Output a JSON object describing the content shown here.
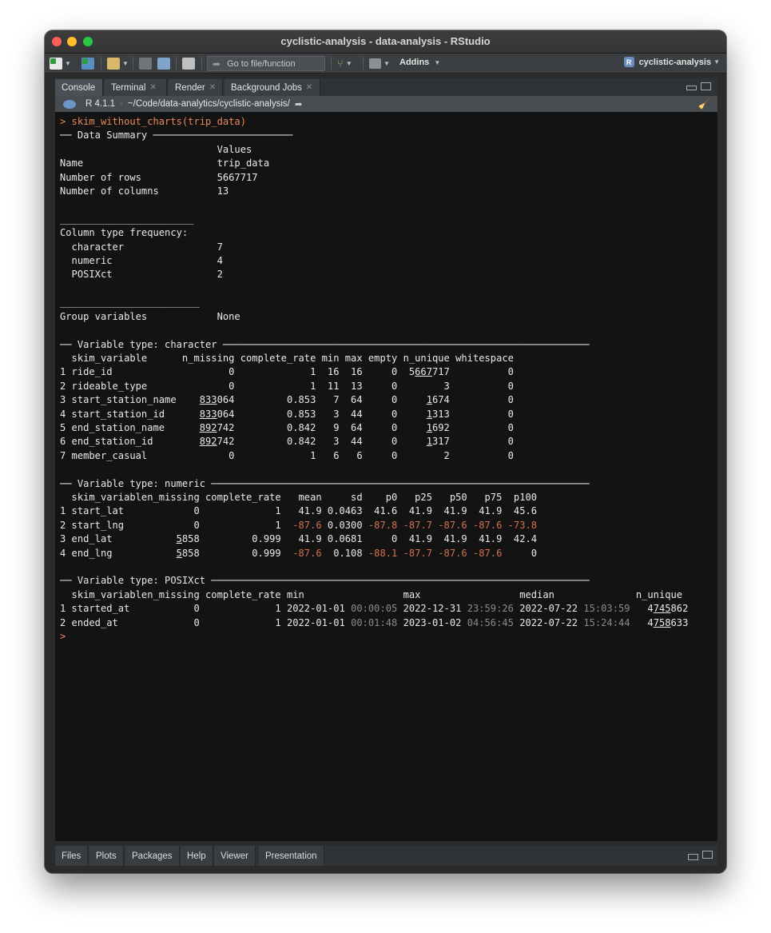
{
  "window": {
    "title": "cyclistic-analysis - data-analysis - RStudio"
  },
  "toolbar": {
    "goto_placeholder": "Go to file/function",
    "addins_label": "Addins",
    "project_label": "cyclistic-analysis"
  },
  "pane_tabs": [
    {
      "label": "Console"
    },
    {
      "label": "Terminal"
    },
    {
      "label": "Render"
    },
    {
      "label": "Background Jobs"
    }
  ],
  "console_path": {
    "r_version": "R 4.1.1",
    "path": "~/Code/data-analytics/cyclistic-analysis/"
  },
  "command": "skim_without_charts(trip_data)",
  "summary": {
    "header": "── Data Summary ────────────────────────",
    "values_header": "Values",
    "rows": [
      {
        "label": "Name",
        "value": "trip_data"
      },
      {
        "label": "Number of rows",
        "value": "5667717"
      },
      {
        "label": "Number of columns",
        "value": "13"
      }
    ],
    "separator1": "_______________________",
    "coltype_label": "Column type frequency:",
    "coltypes": [
      {
        "label": "character",
        "value": "7"
      },
      {
        "label": "numeric",
        "value": "4"
      },
      {
        "label": "POSIXct",
        "value": "2"
      }
    ],
    "separator2": "________________________",
    "group_label": "Group variables",
    "group_value": "None"
  },
  "character_section": {
    "header": "── Variable type: character ───────────────────────────────────────────────────────────────",
    "columns": [
      "skim_variable",
      "n_missing",
      "complete_rate",
      "min",
      "max",
      "empty",
      "n_unique",
      "whitespace"
    ],
    "rows": [
      [
        "1",
        "ride_id",
        "0",
        "1",
        "16",
        "16",
        "0",
        "5667717",
        "0"
      ],
      [
        "2",
        "rideable_type",
        "0",
        "1",
        "11",
        "13",
        "0",
        "3",
        "0"
      ],
      [
        "3",
        "start_station_name",
        "833064",
        "0.853",
        "7",
        "64",
        "0",
        "1674",
        "0"
      ],
      [
        "4",
        "start_station_id",
        "833064",
        "0.853",
        "3",
        "44",
        "0",
        "1313",
        "0"
      ],
      [
        "5",
        "end_station_name",
        "892742",
        "0.842",
        "9",
        "64",
        "0",
        "1692",
        "0"
      ],
      [
        "6",
        "end_station_id",
        "892742",
        "0.842",
        "3",
        "44",
        "0",
        "1317",
        "0"
      ],
      [
        "7",
        "member_casual",
        "0",
        "1",
        "6",
        "6",
        "0",
        "2",
        "0"
      ]
    ]
  },
  "numeric_section": {
    "header": "── Variable type: numeric ─────────────────────────────────────────────────────────────────",
    "columns": [
      "skim_variable",
      "n_missing",
      "complete_rate",
      "mean",
      "sd",
      "p0",
      "p25",
      "p50",
      "p75",
      "p100"
    ],
    "rows": [
      [
        "1",
        "start_lat",
        "0",
        "1",
        "41.9",
        "0.0463",
        "41.6",
        "41.9",
        "41.9",
        "41.9",
        "45.6"
      ],
      [
        "2",
        "start_lng",
        "0",
        "1",
        "-87.6",
        "0.0300",
        "-87.8",
        "-87.7",
        "-87.6",
        "-87.6",
        "-73.8"
      ],
      [
        "3",
        "end_lat",
        "5858",
        "0.999",
        "41.9",
        "0.0681",
        "0",
        "41.9",
        "41.9",
        "41.9",
        "42.4"
      ],
      [
        "4",
        "end_lng",
        "5858",
        "0.999",
        "-87.6",
        "0.108",
        "-88.1",
        "-87.7",
        "-87.6",
        "-87.6",
        "0"
      ]
    ]
  },
  "posix_section": {
    "header": "── Variable type: POSIXct ─────────────────────────────────────────────────────────────────",
    "columns": [
      "skim_variable",
      "n_missing",
      "complete_rate",
      "min",
      "max",
      "median",
      "n_unique"
    ],
    "rows": [
      [
        "1",
        "started_at",
        "0",
        "1",
        "2022-01-01",
        "00:00:05",
        "2022-12-31",
        "23:59:26",
        "2022-07-22",
        "15:03:59",
        "4745862"
      ],
      [
        "2",
        "ended_at",
        "0",
        "1",
        "2022-01-01",
        "00:01:48",
        "2023-01-02",
        "04:56:45",
        "2022-07-22",
        "15:24:44",
        "4758633"
      ]
    ]
  },
  "prompt_symbol": ">",
  "bottom_tabs": [
    {
      "label": "Files"
    },
    {
      "label": "Plots"
    },
    {
      "label": "Packages"
    },
    {
      "label": "Help"
    },
    {
      "label": "Viewer"
    },
    {
      "label": "Presentation"
    }
  ],
  "colors": {
    "prompt": "#e8895a",
    "negative": "#d2704f",
    "dim": "#8a8a8a",
    "console_bg": "#131313"
  }
}
